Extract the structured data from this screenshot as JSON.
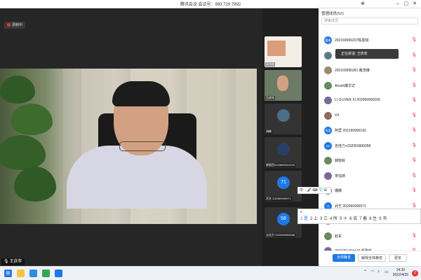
{
  "window": {
    "title": "腾讯会议 会议号：993 729 7992"
  },
  "recording": {
    "label": "录制中"
  },
  "main_video": {
    "speaker_label": "王庆年"
  },
  "thumbnails": [
    {
      "label": "梁伟航"
    },
    {
      "label": "王庆年"
    },
    {
      "label": "谢峰"
    },
    {
      "label": "颜超西2018699010153"
    },
    {
      "label": "武艺 202069990071",
      "avatar_text": "71"
    },
    {
      "label": "吉佳力+202069990058",
      "avatar_text": "58"
    }
  ],
  "panel": {
    "header": "管理成员(52)",
    "search_placeholder": "搜索成员",
    "members": [
      {
        "name": "202169990207陈嘉琪",
        "avatar": "嘉琪"
      },
      {
        "name": "202",
        "avatar": ""
      },
      {
        "name": "202169990281 戴浩琳",
        "avatar": ""
      },
      {
        "name": "Anush庸华达",
        "avatar": ""
      },
      {
        "name": "LI OLIVER XI 202069990206",
        "avatar": ""
      },
      {
        "name": "XX",
        "avatar": ""
      },
      {
        "name": "阿里 202169990192",
        "avatar": "阿里"
      },
      {
        "name": "吉佳力+202069990058",
        "avatar": "58"
      },
      {
        "name": "郝晓秋",
        "avatar": ""
      },
      {
        "name": "李钰婷",
        "avatar": ""
      },
      {
        "name": "珊珊",
        "avatar": ""
      },
      {
        "name": "武艺 202069990071",
        "avatar": "71"
      },
      {
        "name": "伊瑞娜-201969990231",
        "avatar": ""
      },
      {
        "name": "赵军",
        "avatar": ""
      },
      {
        "name": "2019201494443 廖瑾娟",
        "avatar": ""
      }
    ],
    "speaking_popup": "正在讲话: 王庆年",
    "footer": {
      "mute_all": "全体静音",
      "unmute_all": "解除全体静音",
      "more": "更多"
    }
  },
  "ime": {
    "toolbar": "中 ·, 🎤 ⌨ 👕 ⊞",
    "input": "s",
    "candidates": [
      "1 是",
      "2 上",
      "3 三",
      "4 所",
      "5 十",
      "6 说",
      "7 着",
      "8 生",
      "9 书"
    ]
  },
  "taskbar": {
    "time": "14:30",
    "date": "2022/4/26",
    "badge": "2"
  },
  "colors": {
    "accent": "#1e78e6",
    "mic_off": "#e33333"
  }
}
